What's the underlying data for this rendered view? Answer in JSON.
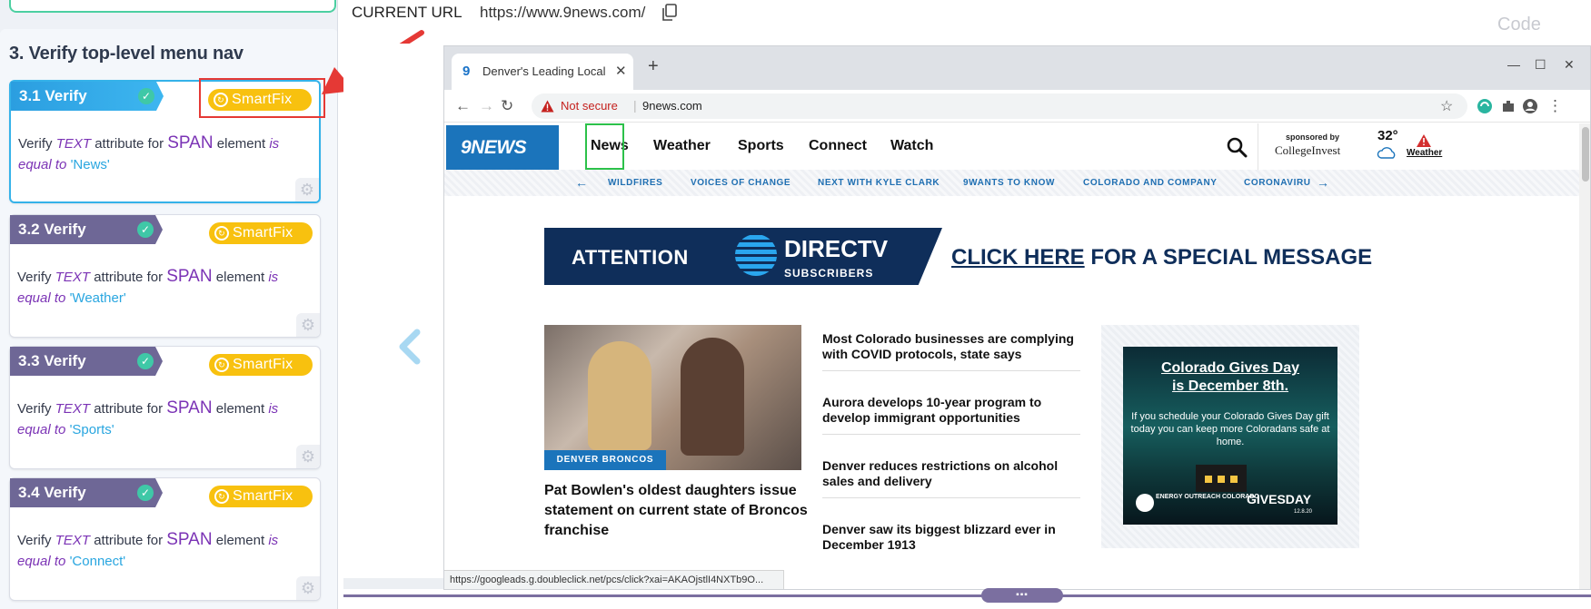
{
  "left_panel": {
    "section_title": "3. Verify top-level menu nav",
    "smartfix_label": "SmartFix",
    "steps": [
      {
        "label": "3.1 Verify",
        "prefix": "Verify",
        "kw_text": "TEXT",
        "mid": "attribute for",
        "tag": "SPAN",
        "element_word": "element",
        "kw_is": "is",
        "kw_equal": "equal to",
        "value": "'News'"
      },
      {
        "label": "3.2 Verify",
        "prefix": "Verify",
        "kw_text": "TEXT",
        "mid": "attribute for",
        "tag": "SPAN",
        "element_word": "element",
        "kw_is": "is",
        "kw_equal": "equal to",
        "value": "'Weather'"
      },
      {
        "label": "3.3 Verify",
        "prefix": "Verify",
        "kw_text": "TEXT",
        "mid": "attribute for",
        "tag": "SPAN",
        "element_word": "element",
        "kw_is": "is",
        "kw_equal": "equal to",
        "value": "'Sports'"
      },
      {
        "label": "3.4 Verify",
        "prefix": "Verify",
        "kw_text": "TEXT",
        "mid": "attribute for",
        "tag": "SPAN",
        "element_word": "element",
        "kw_is": "is",
        "kw_equal": "equal to",
        "value": "'Connect'"
      }
    ]
  },
  "top_bar": {
    "current_url_label": "CURRENT URL",
    "current_url_value": "https://www.9news.com/",
    "code_label": "Code"
  },
  "browser": {
    "tab_title": "Denver's Leading Local Ne",
    "not_secure": "Not secure",
    "omni_url": "9news.com",
    "status_url": "https://googleads.g.doubleclick.net/pcs/click?xai=AKAOjstlI4NXTb9O..."
  },
  "site": {
    "logo": "9NEWS",
    "nav": [
      "News",
      "Weather",
      "Sports",
      "Connect",
      "Watch"
    ],
    "sponsored_by": "sponsored by",
    "sponsor_name": "CollegeInvest",
    "temperature": "32°",
    "weather_label": "Weather",
    "subnav": [
      "WILDFIRES",
      "VOICES OF CHANGE",
      "NEXT WITH KYLE CLARK",
      "9WANTS TO KNOW",
      "COLORADO AND COMPANY",
      "CORONAVIRU"
    ],
    "ad": {
      "attention": "ATTENTION",
      "directv": "DIRECTV",
      "subscribers": "SUBSCRIBERS",
      "click_here": "CLICK HERE",
      "rest": " FOR A SPECIAL MESSAGE"
    },
    "photo_tag": "DENVER BRONCOS",
    "main_headline": "Pat Bowlen's oldest daughters issue statement on current state of Broncos franchise",
    "stories": [
      "Most Colorado businesses are complying with COVID protocols, state says",
      "Aurora develops 10-year program to develop immigrant opportunities",
      "Denver reduces restrictions on alcohol sales and delivery",
      "Denver saw its biggest blizzard ever in December 1913"
    ],
    "side_ad": {
      "title_line1": "Colorado Gives Day",
      "title_line2": "is December 8th.",
      "body": "If you schedule your Colorado Gives Day gift today you can keep more Coloradans safe at home.",
      "energy": "ENERGY OUTREACH COLORADO",
      "gives": "GIVESDAY",
      "date": "12.8.20"
    }
  },
  "colors": {
    "accent_blue": "#35b2e9",
    "smartfix_yellow": "#f8c10f",
    "step_purple": "#6e6796",
    "highlight_red": "#e53935",
    "nav_highlight_green": "#2cc14a",
    "site_blue": "#1b74bb"
  }
}
